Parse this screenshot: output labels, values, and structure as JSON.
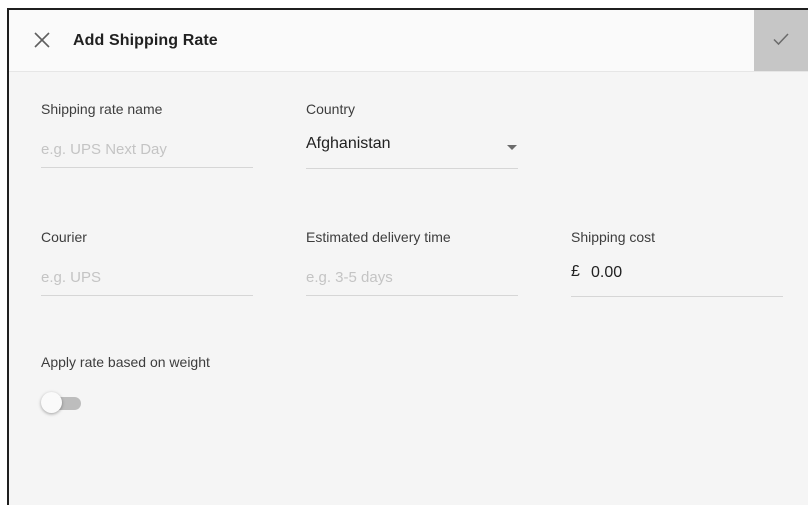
{
  "dialog": {
    "title": "Add Shipping Rate",
    "close_icon": "close-icon",
    "confirm_icon": "check-icon"
  },
  "form": {
    "rate_name": {
      "label": "Shipping rate name",
      "placeholder": "e.g. UPS Next Day",
      "value": ""
    },
    "country": {
      "label": "Country",
      "selected": "Afghanistan",
      "caret_icon": "caret-down-icon"
    },
    "courier": {
      "label": "Courier",
      "placeholder": "e.g. UPS",
      "value": ""
    },
    "delivery_time": {
      "label": "Estimated delivery time",
      "placeholder": "e.g. 3-5 days",
      "value": ""
    },
    "shipping_cost": {
      "label": "Shipping cost",
      "currency": "£",
      "value": "0.00"
    },
    "weight_toggle": {
      "label": "Apply rate based on weight",
      "enabled": false
    }
  },
  "colors": {
    "panel_background": "#f5f5f5",
    "confirm_button": "#c6c6c6",
    "placeholder_text": "#c4c4c4"
  }
}
